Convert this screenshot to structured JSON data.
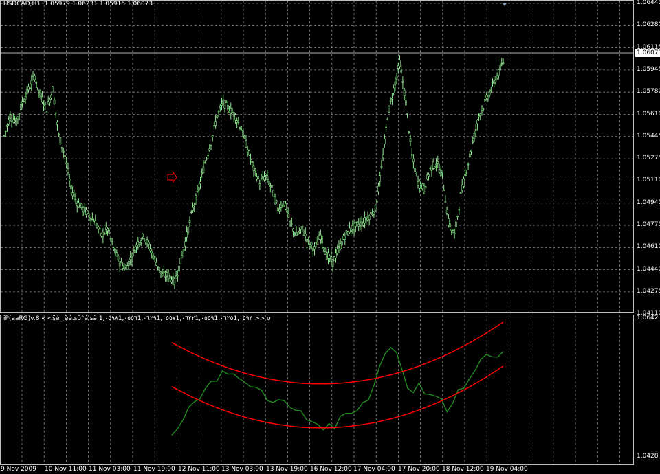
{
  "chart": {
    "symbol_header": "USDCAD,H1  1.05979 1.06231 1.05915 1.06073",
    "current_price": "1.06073",
    "price_axis": [
      "1.06445",
      "1.06280",
      "1.06115",
      "1.05945",
      "1.05780",
      "1.05610",
      "1.05445",
      "1.05275",
      "1.05110",
      "1.04945",
      "1.04775",
      "1.04610",
      "1.04440",
      "1.04275",
      "1.04110"
    ],
    "candle_color": "#90ee90",
    "grid_color": "#8a8a8a",
    "arrow_color": "#ff0000"
  },
  "indicator": {
    "title": "iP(aaRG)v.8 « <ş̈é_ ̧ëé.sô°é.sà 1,٠٥٩٨1,٠٥٥٦1,٠٦٢٩1,٠٥٥٧1,٠٦٢٢1,٠٥٥٩1,٠٦٢٥1,٠٥٩٣ >> o̧",
    "axis_top": "1.0642",
    "axis_bottom": "1.0428",
    "line_color": "#228b22",
    "band_color": "#ff0000"
  },
  "time_axis": [
    "9 Nov 2009",
    "10 Nov 11:00",
    "11 Nov 03:00",
    "11 Nov 19:00",
    "12 Nov 11:00",
    "13 Nov 03:00",
    "13 Nov 19:00",
    "16 Nov 12:00",
    "17 Nov 04:00",
    "17 Nov 20:00",
    "18 Nov 12:00",
    "19 Nov 04:00"
  ],
  "chart_data": {
    "type": "candlestick",
    "title": "USDCAD,H1",
    "ylim": [
      1.0411,
      1.06445
    ],
    "close": [
      1.0545,
      1.056,
      1.0555,
      1.057,
      1.058,
      1.059,
      1.0575,
      1.0565,
      1.058,
      1.0545,
      1.053,
      1.0505,
      1.0495,
      1.049,
      1.0485,
      1.048,
      1.047,
      1.0475,
      1.046,
      1.045,
      1.0445,
      1.0455,
      1.0465,
      1.047,
      1.046,
      1.045,
      1.044,
      1.044,
      1.0435,
      1.045,
      1.047,
      1.049,
      1.0505,
      1.0525,
      1.054,
      1.056,
      1.057,
      1.0565,
      1.056,
      1.055,
      1.0535,
      1.052,
      1.051,
      1.0515,
      1.0505,
      1.049,
      1.0495,
      1.048,
      1.047,
      1.0475,
      1.0465,
      1.046,
      1.047,
      1.0455,
      1.045,
      1.046,
      1.047,
      1.0475,
      1.0478,
      1.048,
      1.0485,
      1.049,
      1.052,
      1.056,
      1.058,
      1.06,
      1.057,
      1.053,
      1.051,
      1.0505,
      1.052,
      1.0525,
      1.0515,
      1.048,
      1.047,
      1.05,
      1.052,
      1.054,
      1.056,
      1.057,
      1.058,
      1.059,
      1.06
    ]
  }
}
